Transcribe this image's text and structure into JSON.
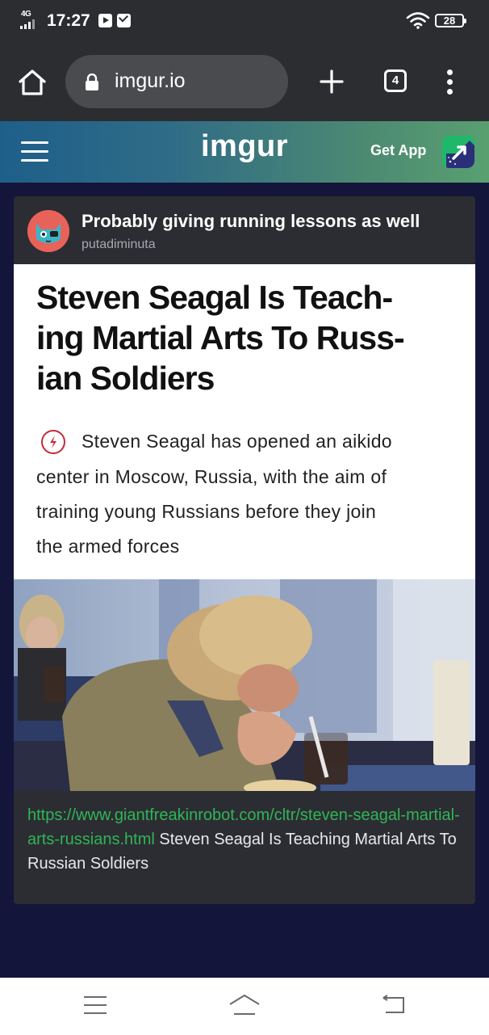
{
  "status_bar": {
    "network": "4G",
    "time": "17:27",
    "battery": "28"
  },
  "browser": {
    "url": "imgur.io",
    "tab_count": "4"
  },
  "imgur_header": {
    "logo": "imgur",
    "get_app_label": "Get App"
  },
  "post": {
    "title": "Probably giving running lessons as well",
    "author": "putadiminuta",
    "article": {
      "headline_lines": [
        "Steven Seagal Is Teach-",
        "ing Martial Arts To Russ-",
        "ian Soldiers"
      ],
      "body_lines": [
        "Steven Seagal has opened an aikido",
        "center in Moscow, Russia, with the aim of",
        "training young Russians before they join",
        "the armed forces"
      ]
    },
    "caption": {
      "link": "https://www.giantfreakinrobot.com/cltr/steven-seagal-martial-arts-russians.html",
      "text": "Steven Seagal Is Teaching Martial Arts To Russian Soldiers"
    }
  },
  "icons": {
    "status": [
      "youtube-icon",
      "mail-icon",
      "wifi-icon",
      "battery-icon"
    ],
    "browser": [
      "home-icon",
      "lock-icon",
      "plus-icon",
      "tabs-icon",
      "more-vert-icon"
    ],
    "page": [
      "hamburger-icon",
      "get-app-icon",
      "avatar",
      "alert-icon"
    ],
    "nav": [
      "menu-icon",
      "home-icon",
      "back-icon"
    ]
  },
  "colors": {
    "status_bg": "#2c2d30",
    "content_bg": "#14153a",
    "card_bg": "#2c2d32",
    "link_green": "#2fb556",
    "alert_red": "#c6293b"
  }
}
